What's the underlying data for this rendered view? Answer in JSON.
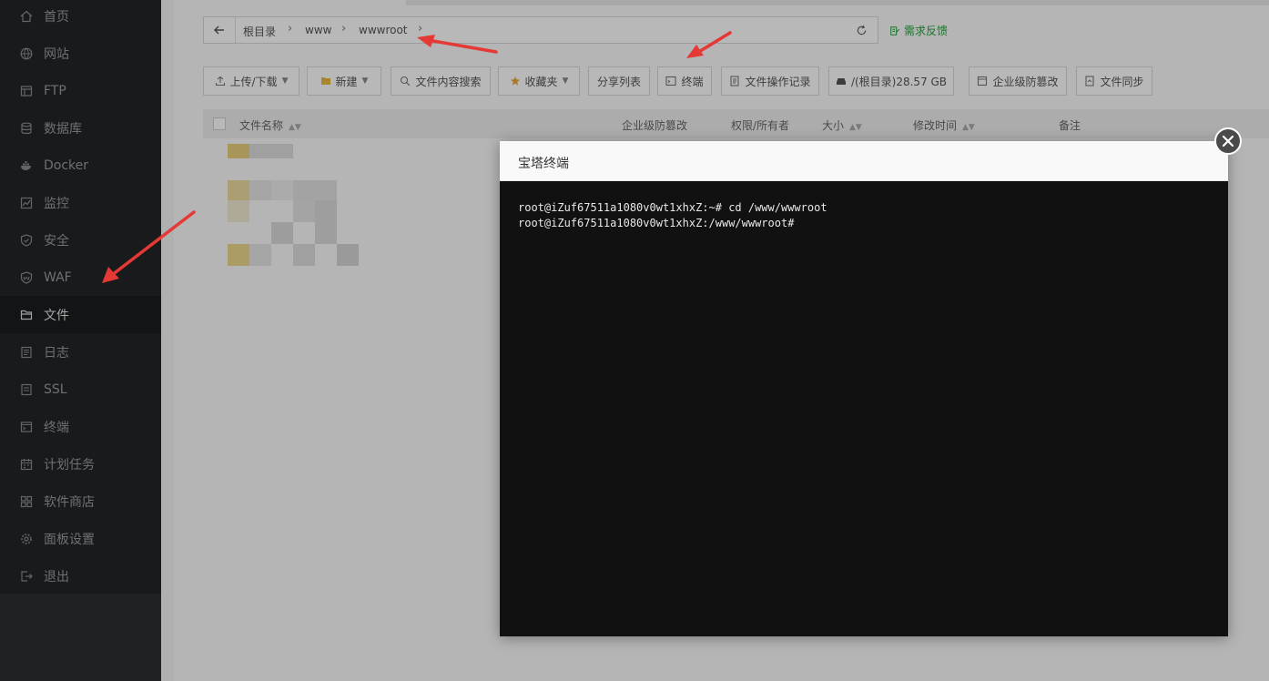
{
  "sidebar": {
    "items": [
      {
        "label": "首页",
        "icon": "home-icon"
      },
      {
        "label": "网站",
        "icon": "globe-icon"
      },
      {
        "label": "FTP",
        "icon": "ftp-icon"
      },
      {
        "label": "数据库",
        "icon": "database-icon"
      },
      {
        "label": "Docker",
        "icon": "docker-icon"
      },
      {
        "label": "监控",
        "icon": "monitor-icon"
      },
      {
        "label": "安全",
        "icon": "shield-icon"
      },
      {
        "label": "WAF",
        "icon": "waf-icon"
      },
      {
        "label": "文件",
        "icon": "folder-icon",
        "active": true
      },
      {
        "label": "日志",
        "icon": "log-icon"
      },
      {
        "label": "SSL",
        "icon": "ssl-icon"
      },
      {
        "label": "终端",
        "icon": "terminal-icon"
      },
      {
        "label": "计划任务",
        "icon": "calendar-icon"
      },
      {
        "label": "软件商店",
        "icon": "grid-icon"
      },
      {
        "label": "面板设置",
        "icon": "gear-icon"
      },
      {
        "label": "退出",
        "icon": "logout-icon"
      }
    ]
  },
  "breadcrumb": {
    "items": [
      "根目录",
      "www",
      "wwwroot"
    ],
    "separator": "›"
  },
  "feedback_label": "需求反馈",
  "toolbar": {
    "upload": "上传/下载",
    "new": "新建",
    "search": "文件内容搜索",
    "favorites": "收藏夹",
    "share_list": "分享列表",
    "terminal": "终端",
    "file_log": "文件操作记录",
    "disk": "/(根目录)28.57 GB",
    "tamper": "企业级防篡改",
    "sync": "文件同步"
  },
  "table": {
    "headers": {
      "name": "文件名称",
      "tamper": "企业级防篡改",
      "perm": "权限/所有者",
      "size": "大小",
      "mtime": "修改时间",
      "note": "备注"
    }
  },
  "modal": {
    "title": "宝塔终端",
    "lines": [
      "root@iZuf67511a1080v0wt1xhxZ:~# cd /www/wwwroot",
      "root@iZuf67511a1080v0wt1xhxZ:/www/wwwroot#"
    ]
  },
  "colors": {
    "accent_green": "#20a53a",
    "sidebar_bg": "#232528",
    "terminal_bg": "#111111",
    "annotation_red": "#e53935"
  }
}
